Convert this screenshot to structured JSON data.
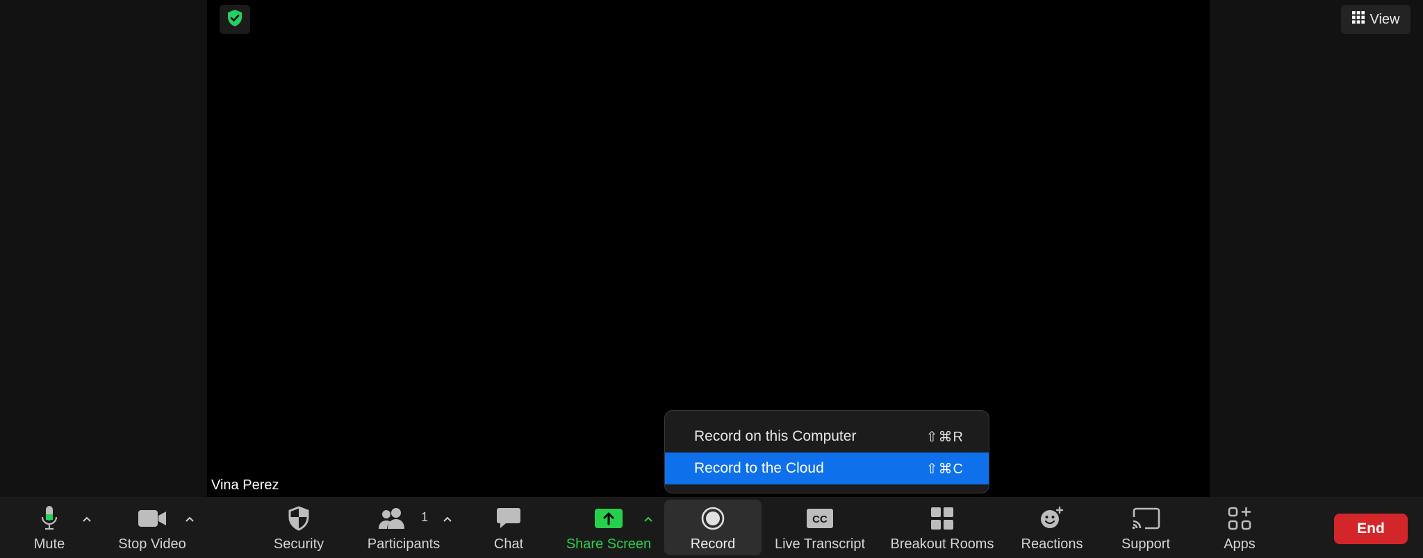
{
  "view_button": {
    "label": "View"
  },
  "participant": {
    "name": "Vina Perez"
  },
  "record_menu": {
    "items": [
      {
        "label": "Record on this Computer",
        "shortcut": "⇧⌘R"
      },
      {
        "label": "Record to the Cloud",
        "shortcut": "⇧⌘C"
      }
    ]
  },
  "toolbar": {
    "mute": "Mute",
    "stop_video": "Stop Video",
    "security": "Security",
    "participants": "Participants",
    "participants_count": "1",
    "chat": "Chat",
    "share_screen": "Share Screen",
    "record": "Record",
    "live_transcript": "Live Transcript",
    "cc_text": "CC",
    "breakout_rooms": "Breakout Rooms",
    "reactions": "Reactions",
    "support": "Support",
    "apps": "Apps",
    "end": "End"
  },
  "colors": {
    "accent_blue": "#0e71eb",
    "share_green": "#26d04c",
    "end_red": "#d3262b",
    "secure_green": "#23d160"
  }
}
